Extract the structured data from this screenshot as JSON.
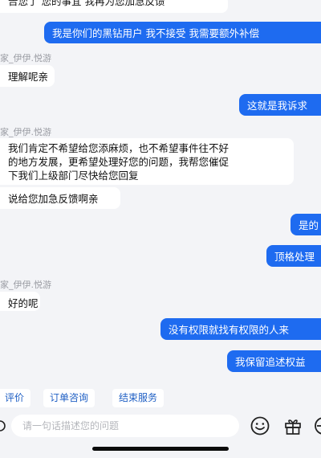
{
  "messages": [
    {
      "side": "left",
      "lines": [
        "告您了 您的事宜 我再为您加急反馈"
      ]
    },
    {
      "side": "right",
      "lines": [
        "我是你们的黑钻用户 我不接受 我需要额外补偿"
      ]
    },
    {
      "side": "nick",
      "text": "家_伊伊.悦游"
    },
    {
      "side": "left",
      "lines": [
        "理解呢亲"
      ]
    },
    {
      "side": "right",
      "lines": [
        "这就是我诉求"
      ]
    },
    {
      "side": "nick",
      "text": "家_伊伊.悦游"
    },
    {
      "side": "left",
      "lines": [
        "我们肯定不希望给您添麻烦，也不希望事件往不好",
        "的地方发展，更希望处理好您的问题，我帮您催促",
        "下我们上级部门尽快给您回复"
      ]
    },
    {
      "side": "left",
      "lines": [
        "说给您加急反馈啊亲"
      ]
    },
    {
      "side": "right",
      "lines": [
        "是的"
      ]
    },
    {
      "side": "right",
      "lines": [
        "顶格处理"
      ]
    },
    {
      "side": "nick",
      "text": "家_伊伊.悦游"
    },
    {
      "side": "left",
      "lines": [
        "好的呢"
      ]
    },
    {
      "side": "right",
      "lines": [
        "没有权限就找有权限的人来"
      ]
    },
    {
      "side": "right",
      "lines": [
        "我保留追述权益"
      ]
    }
  ],
  "quick_replies": [
    "评价",
    "订单咨询",
    "结束服务"
  ],
  "input": {
    "placeholder": "请一句话描述您的问题"
  },
  "colors": {
    "background": "#f3f4f7",
    "user_bubble": "#1e6bf0",
    "agent_bubble": "#ffffff",
    "chip_text": "#1f5fc4"
  },
  "icons": {
    "left": "voice-icon",
    "emoji": "emoji-icon",
    "gift": "gift-icon",
    "plus": "plus-icon"
  }
}
